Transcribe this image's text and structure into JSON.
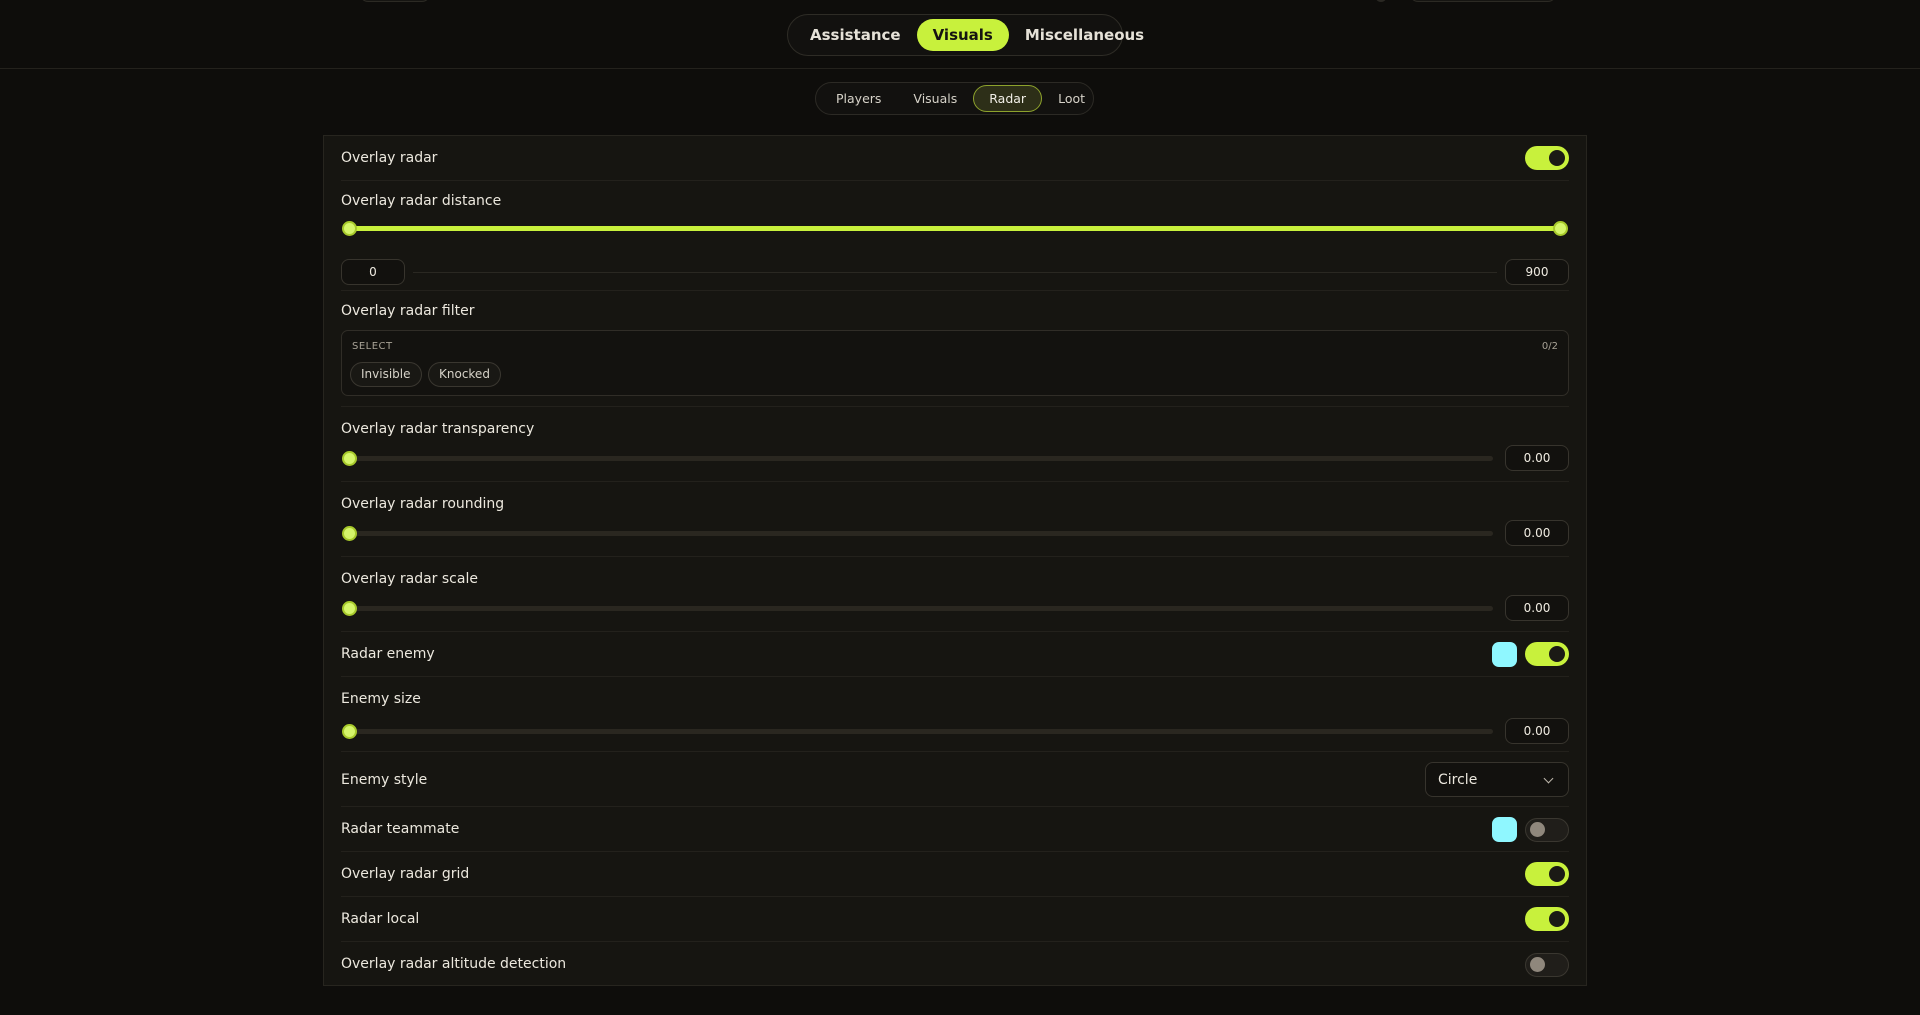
{
  "main_tabs": [
    "Assistance",
    "Visuals",
    "Miscellaneous"
  ],
  "main_tab_active": "Visuals",
  "sub_tabs": [
    "Players",
    "Visuals",
    "Radar",
    "Loot"
  ],
  "sub_tab_active": "Radar",
  "settings": {
    "overlay_radar": {
      "label": "Overlay radar",
      "enabled": true
    },
    "overlay_radar_distance": {
      "label": "Overlay radar distance",
      "min": "0",
      "max": "900",
      "low": 0,
      "high": 900,
      "range": [
        0,
        900
      ]
    },
    "overlay_radar_filter": {
      "label": "Overlay radar filter",
      "select_title": "SELECT",
      "count": "0/2",
      "options": [
        "Invisible",
        "Knocked"
      ]
    },
    "overlay_radar_transparency": {
      "label": "Overlay radar transparency",
      "value": "0.00",
      "fraction": 0
    },
    "overlay_radar_rounding": {
      "label": "Overlay radar rounding",
      "value": "0.00",
      "fraction": 0
    },
    "overlay_radar_scale": {
      "label": "Overlay radar scale",
      "value": "0.00",
      "fraction": 0
    },
    "radar_enemy": {
      "label": "Radar enemy",
      "color": "#8ff7ff",
      "enabled": true
    },
    "enemy_size": {
      "label": "Enemy size",
      "value": "0.00",
      "fraction": 0
    },
    "enemy_style": {
      "label": "Enemy style",
      "value": "Circle"
    },
    "radar_teammate": {
      "label": "Radar teammate",
      "color": "#8ff7ff",
      "enabled": false
    },
    "overlay_radar_grid": {
      "label": "Overlay radar grid",
      "enabled": true
    },
    "radar_local": {
      "label": "Radar local",
      "enabled": true
    },
    "overlay_radar_altitude_detection": {
      "label": "Overlay radar altitude detection",
      "enabled": false
    }
  },
  "colors": {
    "accent": "#c8f13c",
    "background": "#0e0d0b",
    "panel": "#161511"
  }
}
